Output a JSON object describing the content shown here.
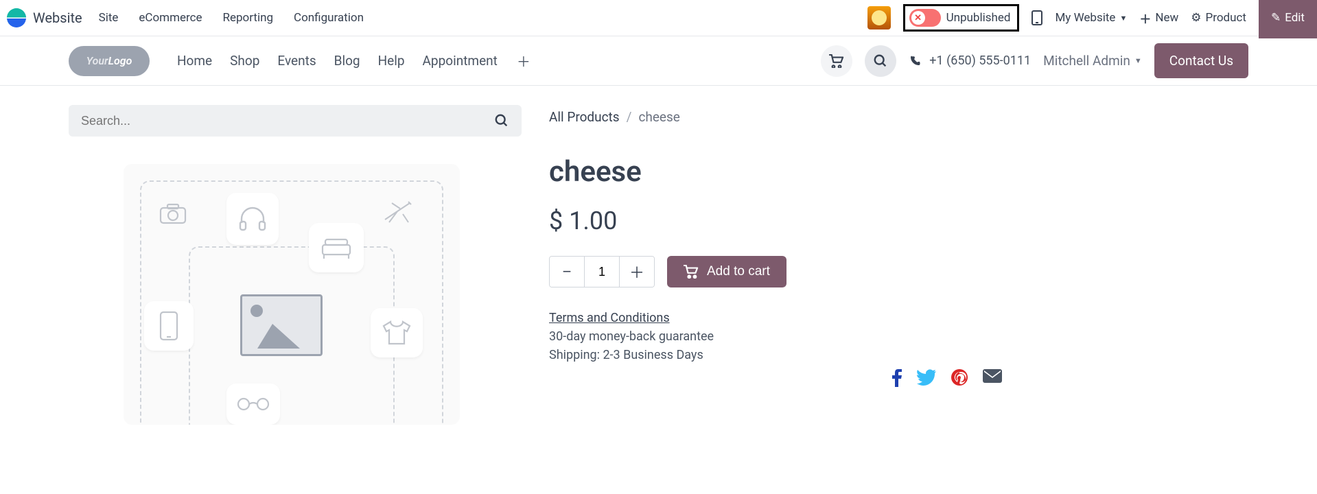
{
  "sysbar": {
    "brand": "Website",
    "nav": [
      "Site",
      "eCommerce",
      "Reporting",
      "Configuration"
    ],
    "publish_label": "Unpublished",
    "website_selector": "My Website",
    "new_label": "New",
    "product_label": "Product",
    "edit_label": "Edit"
  },
  "sitebar": {
    "logo_text": "YourLogo",
    "nav": [
      "Home",
      "Shop",
      "Events",
      "Blog",
      "Help",
      "Appointment"
    ],
    "phone": "+1 (650) 555-0111",
    "user": "Mitchell Admin",
    "contact_label": "Contact Us"
  },
  "search": {
    "placeholder": "Search..."
  },
  "breadcrumb": {
    "root": "All Products",
    "current": "cheese"
  },
  "product": {
    "name": "cheese",
    "currency": "$",
    "price": "1.00",
    "qty": "1",
    "add_label": "Add to cart",
    "terms_label": "Terms and Conditions",
    "guarantee": "30-day money-back guarantee",
    "shipping": "Shipping: 2-3 Business Days"
  }
}
